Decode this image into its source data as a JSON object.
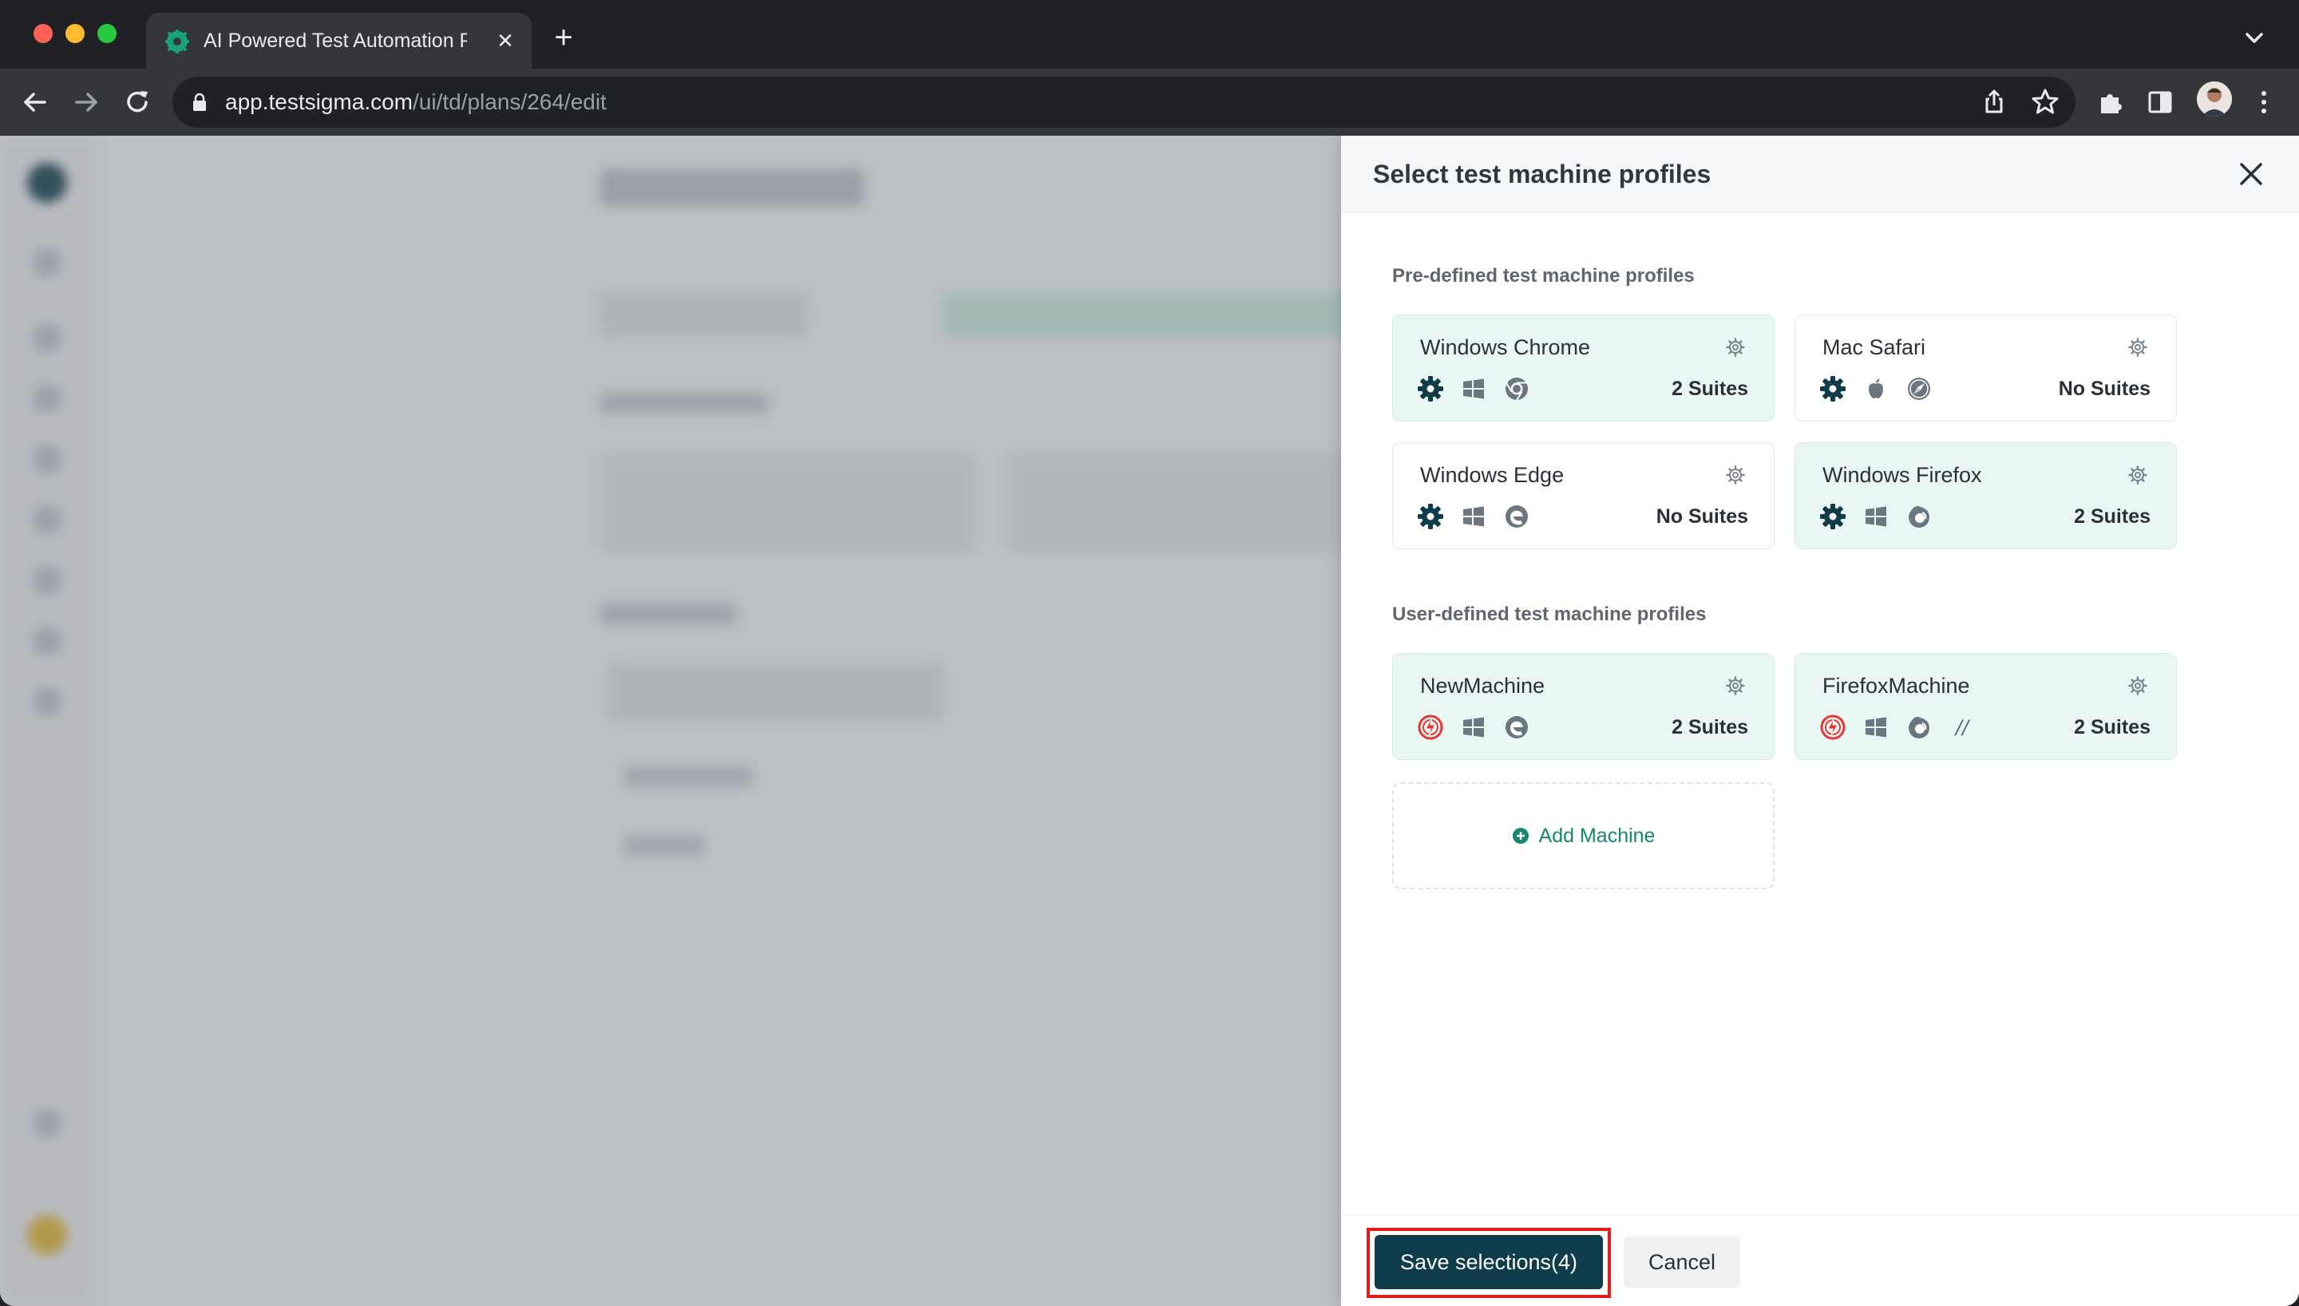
{
  "browser": {
    "tab_title": "AI Powered Test Automation P",
    "tab_close_glyph": "✕",
    "new_tab_glyph": "+",
    "url_host": "app.testsigma.com",
    "url_path": "/ui/td/plans/264/edit"
  },
  "icons": {
    "windows": "windows-icon",
    "mac": "apple-icon",
    "chrome": "chrome-icon",
    "safari": "safari-icon",
    "edge": "edge-icon",
    "firefox": "firefox-icon",
    "testsigma": "testsigma-gear-icon",
    "lambdatest": "lambdatest-icon",
    "settings": "gear-icon"
  },
  "colors": {
    "accent": "#0f3d4c",
    "selected_card": "#eaf6f3",
    "add_link": "#14896c",
    "highlight": "#e11d1d"
  },
  "panel": {
    "title": "Select test machine profiles",
    "predefined_label": "Pre-defined test machine profiles",
    "userdefined_label": "User-defined test machine profiles",
    "predefined": [
      {
        "name": "Windows Chrome",
        "count": "2 Suites",
        "selected": true
      },
      {
        "name": "Mac Safari",
        "count": "No Suites",
        "selected": false
      },
      {
        "name": "Windows Edge",
        "count": "No Suites",
        "selected": false
      },
      {
        "name": "Windows Firefox",
        "count": "2 Suites",
        "selected": true
      }
    ],
    "userdefined": [
      {
        "name": "NewMachine",
        "count": "2 Suites",
        "selected": true
      },
      {
        "name": "FirefoxMachine",
        "count": "2 Suites",
        "selected": true,
        "extra_glyph": "//"
      }
    ],
    "add_machine_label": "Add Machine",
    "save_label": "Save selections(4)",
    "cancel_label": "Cancel"
  }
}
